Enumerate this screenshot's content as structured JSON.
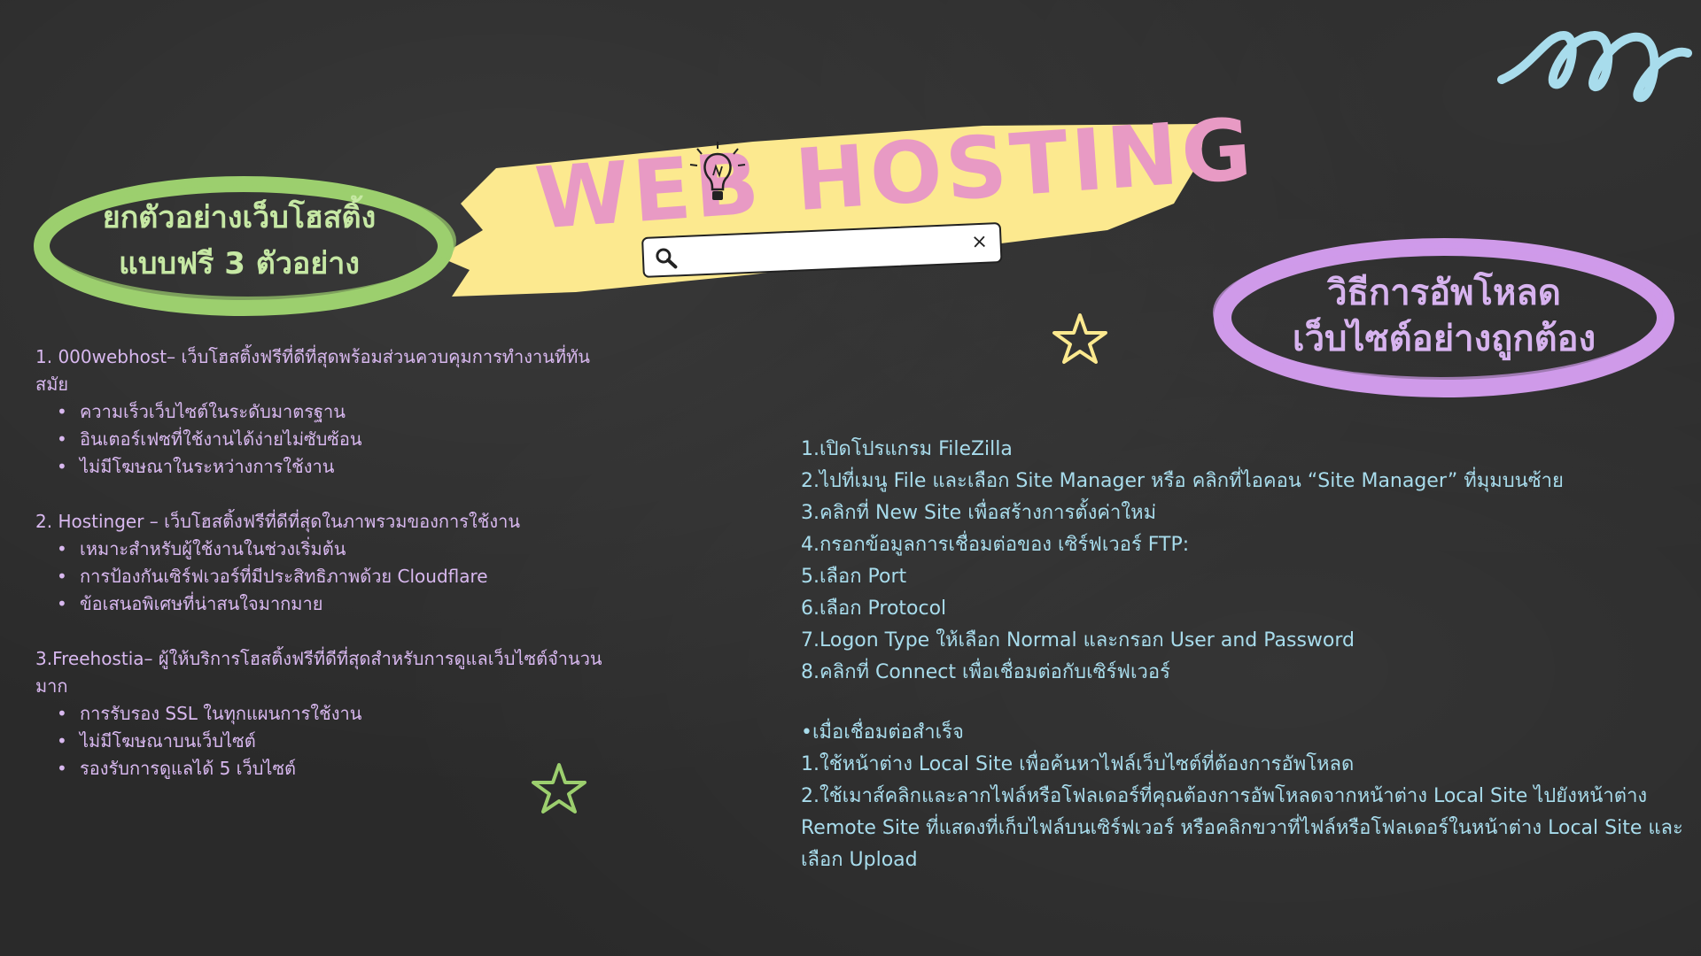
{
  "header": {
    "title": "WEB HOSTING",
    "search": {
      "value": "",
      "placeholder": ""
    }
  },
  "left_badge": {
    "line1": "ยกตัวอย่างเว็บโฮสติ้ง",
    "line2": "แบบฟรี 3 ตัวอย่าง"
  },
  "right_badge": {
    "line1": "วิธีการอัพโหลด",
    "line2": "เว็บไซต์อย่างถูกต้อง"
  },
  "examples": [
    {
      "heading": "1. 000webhost– เว็บโฮสติ้งฟรีที่ดีที่สุดพร้อมส่วนควบคุมการทำงานที่ทันสมัย",
      "bullets": [
        "ความเร็วเว็บไซต์ในระดับมาตรฐาน",
        "อินเตอร์เฟซที่ใช้งานได้ง่ายไม่ซับซ้อน",
        "ไม่มีโฆษณาในระหว่างการใช้งาน"
      ]
    },
    {
      "heading": "2. Hostinger – เว็บโฮสติ้งฟรีที่ดีที่สุดในภาพรวมของการใช้งาน",
      "bullets": [
        "เหมาะสำหรับผู้ใช้งานในช่วงเริ่มต้น",
        "การป้องกันเซิร์ฟเวอร์ที่มีประสิทธิภาพด้วย Cloudflare",
        "ข้อเสนอพิเศษที่น่าสนใจมากมาย"
      ]
    },
    {
      "heading": "3.Freehostia– ผู้ให้บริการโฮสติ้งฟรีที่ดีที่สุดสำหรับการดูแลเว็บไซต์จำนวนมาก",
      "bullets": [
        "การรับรอง SSL ในทุกแผนการใช้งาน",
        "ไม่มีโฆษณาบนเว็บไซต์",
        "รองรับการดูแลได้ 5 เว็บไซต์"
      ]
    }
  ],
  "steps": [
    "1.เปิดโปรแกรม FileZilla",
    "2.ไปที่เมนู File และเลือก Site Manager หรือ คลิกที่ไอคอน “Site Manager” ที่มุมบนซ้าย",
    "3.คลิกที่ New Site เพื่อสร้างการตั้งค่าใหม่",
    "4.กรอกข้อมูลการเชื่อมต่อของ เซิร์ฟเวอร์ FTP:",
    "5.เลือก Port",
    "6.เลือก Protocol",
    "7.Logon Type ให้เลือก Normal และกรอก User and Password",
    "8.คลิกที่ Connect เพื่อเชื่อมต่อกับเซิร์ฟเวอร์"
  ],
  "after_connect": {
    "heading": "•เมื่อเชื่อมต่อสำเร็จ",
    "items": [
      "1.ใช้หน้าต่าง Local Site เพื่อค้นหาไฟล์เว็บไซต์ที่ต้องการอัพโหลด",
      "2.ใช้เมาส์คลิกและลากไฟล์หรือโฟลเดอร์ที่คุณต้องการอัพโหลดจากหน้าต่าง Local Site ไปยังหน้าต่าง Remote Site ที่แสดงที่เก็บไฟล์บนเซิร์ฟเวอร์ หรือคลิกขวาที่ไฟล์หรือโฟลเดอร์ในหน้าต่าง Local Site และเลือก Upload"
    ]
  },
  "icons": {
    "search": "search-icon",
    "clear": "close-icon",
    "bulb": "lightbulb-icon",
    "star": "star-icon",
    "swirl": "swirl-icon"
  },
  "colors": {
    "board": "#2a2a2a",
    "title_pink": "#e89ac4",
    "brush_yellow": "#fce98f",
    "green": "#9ccf6e",
    "green_text": "#c6e8a4",
    "purple": "#cf9ae9",
    "purple_text": "#d7b3ef",
    "list_text": "#d8b8ef",
    "steps_text": "#a8dcec",
    "swirl": "#a8dcec"
  }
}
